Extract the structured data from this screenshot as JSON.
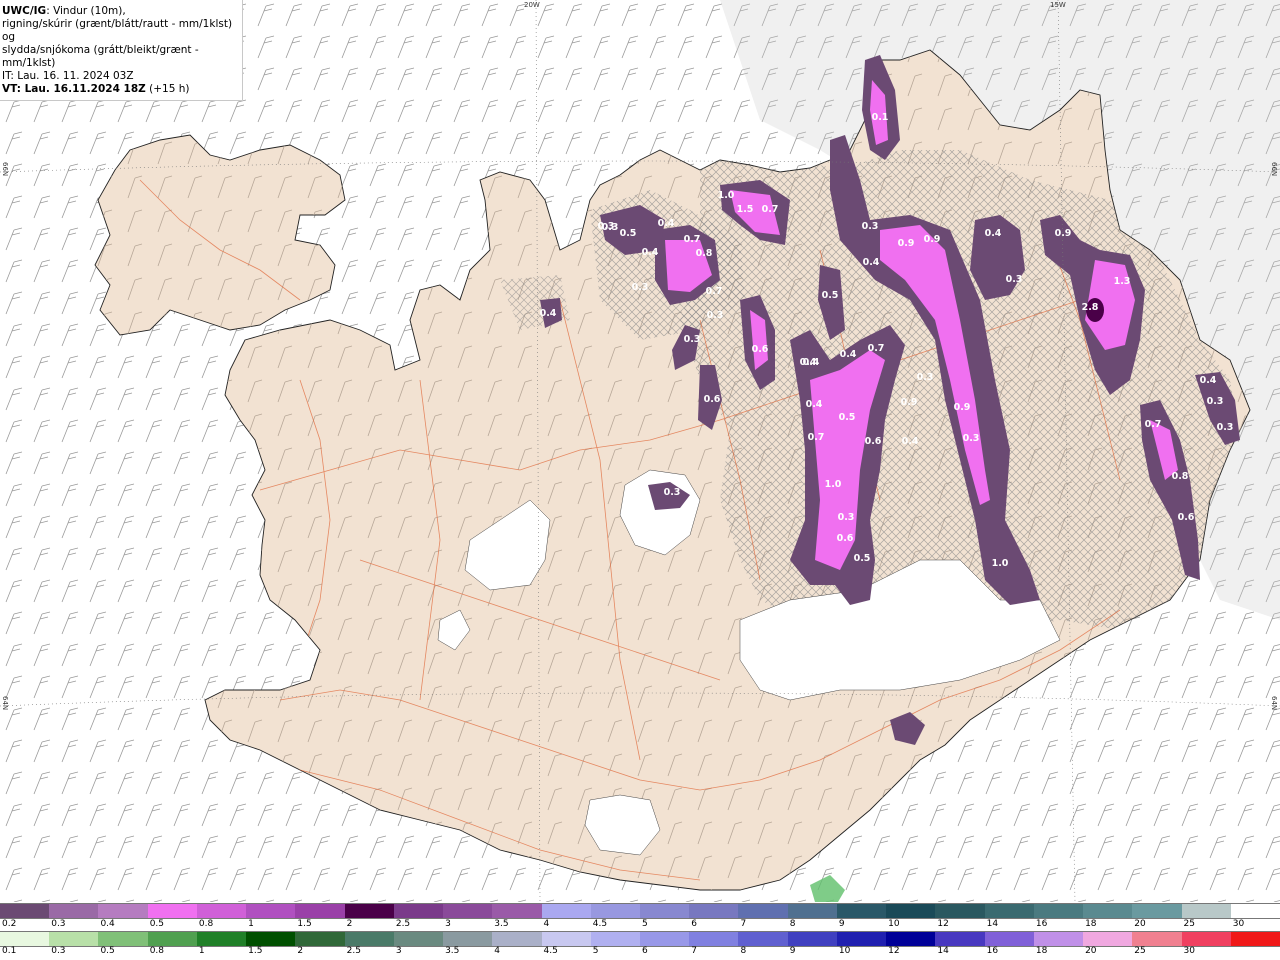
{
  "info": {
    "title_bold": "UWC/IG",
    "title_rest": ": Vindur (10m),",
    "line2": "rigning/skúrir (grænt/blátt/rautt - mm/1klst) og",
    "line3": "slydda/snjókoma (grátt/bleikt/grænt - mm/1klst)",
    "line4": "IT: Lau. 16. 11. 2024 03Z",
    "line5_bold": "VT: Lau. 16.11.2024 18Z",
    "line5_rest": " (+15 h)"
  },
  "graticule": {
    "lon_top": [
      "20W",
      "15W"
    ],
    "lat_left": [
      "66N",
      "64N"
    ],
    "lat_right": [
      "66N",
      "64N"
    ]
  },
  "precip_labels": [
    "0.1",
    "0.3",
    "0.5",
    "0.4",
    "0.7",
    "0.8",
    "1.0",
    "1.5",
    "0.7",
    "0.4",
    "0.3",
    "0.3",
    "0.9",
    "0.9",
    "0.4",
    "0.3",
    "0.4",
    "0.3",
    "0.9",
    "1.3",
    "2.8",
    "0.4",
    "0.5",
    "0.4",
    "0.7",
    "0.7",
    "0.6",
    "0.3",
    "0.4",
    "0.4",
    "0.5",
    "0.6",
    "0.3",
    "0.9",
    "0.9",
    "0.3",
    "1.0",
    "0.6",
    "0.5",
    "1.0",
    "0.7",
    "0.8",
    "0.6",
    "0.3",
    "0.4",
    "0.3",
    "0.3",
    "0.4",
    "0.7",
    "0.3",
    "0.3",
    "0.4",
    "0.6"
  ],
  "legend_snow": {
    "colors": [
      "#6b4a73",
      "#9a6aa6",
      "#b57cc0",
      "#f070f0",
      "#d060d8",
      "#b050c0",
      "#9a40a8",
      "#4a0048",
      "#7a3a8a",
      "#8a4a9a",
      "#9a5aa8",
      "#aaa8f0",
      "#9898e0",
      "#8888d0",
      "#7878c0",
      "#6070b0",
      "#507090",
      "#2a5868",
      "#1a4a58",
      "#2a5860",
      "#3a6a70",
      "#4a7a80",
      "#5a8a90",
      "#6a9aa0",
      "#b8c8c8",
      "#ffffff"
    ],
    "labels": [
      "0.2",
      "0.3",
      "0.4",
      "0.5",
      "0.8",
      "1",
      "1.5",
      "2",
      "2.5",
      "3",
      "3.5",
      "4",
      "4.5",
      "5",
      "6",
      "7",
      "8",
      "9",
      "10",
      "12",
      "14",
      "16",
      "18",
      "20",
      "25",
      "30"
    ]
  },
  "legend_rain": {
    "colors": [
      "#e8f8e0",
      "#b8e0a8",
      "#80c078",
      "#50a050",
      "#208028",
      "#005000",
      "#306838",
      "#4a7a68",
      "#6a8a80",
      "#8a9aa0",
      "#aab0c8",
      "#c8c8f0",
      "#b0b0f0",
      "#9898e8",
      "#8080e0",
      "#6060d0",
      "#4040c0",
      "#2020b0",
      "#000098",
      "#4838c0",
      "#8060d8",
      "#c090e8",
      "#f0a8e0",
      "#f08090",
      "#f04060",
      "#f01818"
    ],
    "labels": [
      "0.1",
      "0.3",
      "0.5",
      "0.8",
      "1",
      "1.5",
      "2",
      "2.5",
      "3",
      "3.5",
      "4",
      "4.5",
      "5",
      "6",
      "7",
      "8",
      "9",
      "10",
      "12",
      "14",
      "16",
      "18",
      "20",
      "25",
      "30"
    ]
  }
}
